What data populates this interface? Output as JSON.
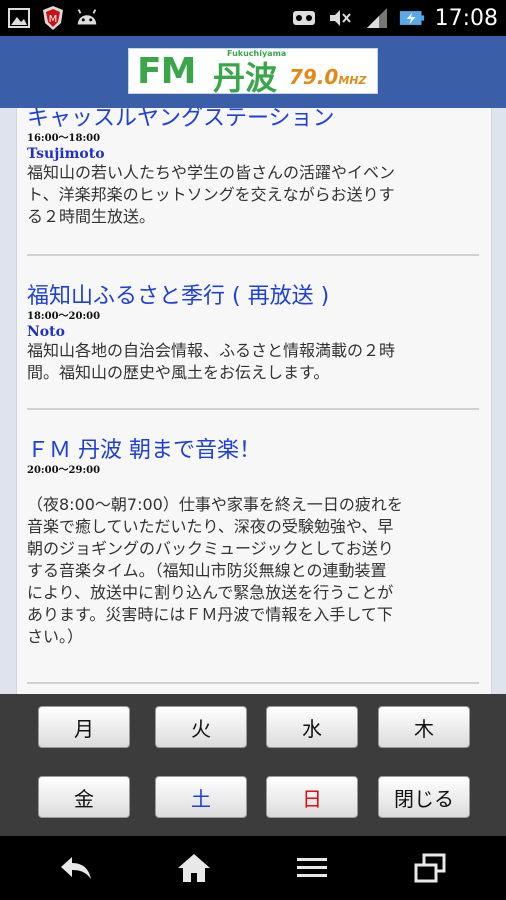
{
  "status_bar": {
    "time": "17:08",
    "icons": [
      "image-icon",
      "mcafee-shield-icon",
      "android-icon",
      "voicemail-icon",
      "mute-icon",
      "lte-signal-icon",
      "battery-charging-icon"
    ]
  },
  "header": {
    "logo": {
      "fm": "FM",
      "tanba": "丹波",
      "sub": "Fukuchiyama",
      "freq": "79.0",
      "unit": "MHZ"
    }
  },
  "programs": [
    {
      "title": "キャッスルヤングステーション",
      "time": "16:00～18:00",
      "host": "Tsujimoto",
      "description_lines": [
        "福知山の若い人たちや学生の皆さんの活躍やイベン",
        "ト、洋楽邦楽のヒットソングを交えながらお送りす",
        "る２時間生放送。"
      ]
    },
    {
      "title": "福知山ふるさと季行 ( 再放送 )",
      "time": "18:00～20:00",
      "host": "Noto",
      "description_lines": [
        "福知山各地の自治会情報、ふるさと情報満載の２時",
        "間。福知山の歴史や風土をお伝えします。"
      ]
    },
    {
      "title": "ＦＭ 丹波 朝まで音楽！",
      "time": "20:00～29:00",
      "host": "",
      "description_lines": [
        "（夜8:00～朝7:00）仕事や家事を終え一日の疲れを",
        "音楽で癒していただいたり、深夜の受験勉強や、早",
        "朝のジョギングのバックミュージックとしてお送り",
        "する音楽タイム。（福知山市防災無線との連動装置",
        "により、放送中に割り込んで緊急放送を行うことが",
        "あります。災害時にはＦＭ丹波で情報を入手して下",
        "さい。）"
      ]
    }
  ],
  "day_buttons": [
    {
      "label": "月",
      "color": "#111111"
    },
    {
      "label": "火",
      "color": "#111111"
    },
    {
      "label": "水",
      "color": "#111111"
    },
    {
      "label": "木",
      "color": "#111111"
    },
    {
      "label": "金",
      "color": "#111111"
    },
    {
      "label": "土",
      "color": "#1f3fd6"
    },
    {
      "label": "日",
      "color": "#e01010"
    },
    {
      "label": "閉じる",
      "color": "#111111"
    }
  ],
  "nav_bar": {
    "icons": [
      "back-icon",
      "home-icon",
      "menu-icon",
      "recent-apps-icon"
    ]
  }
}
